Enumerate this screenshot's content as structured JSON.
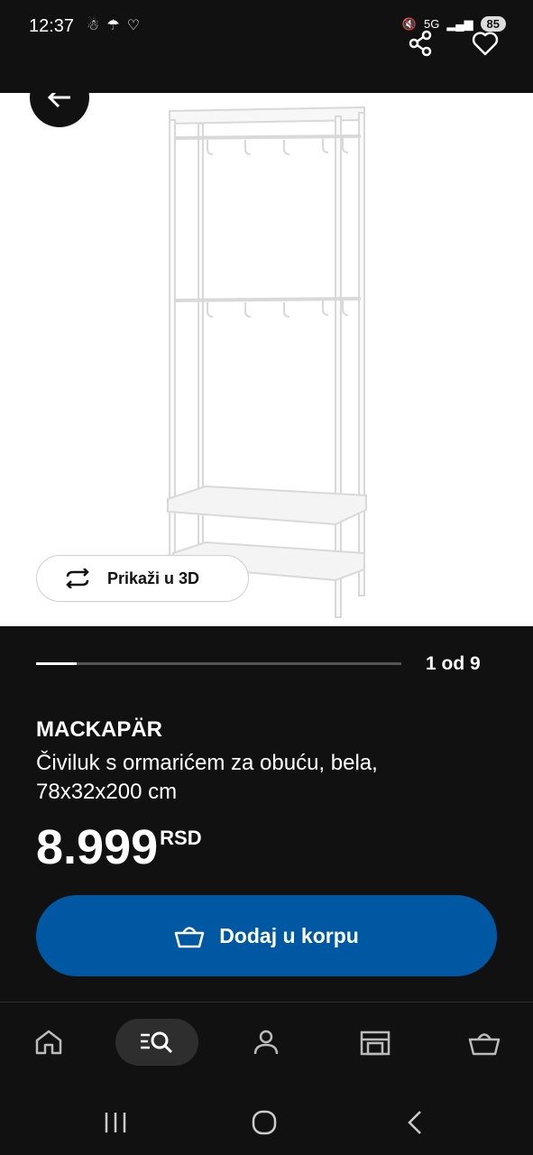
{
  "status_bar": {
    "time": "12:37",
    "network": "5G",
    "battery": "85"
  },
  "header": {
    "back_icon": "arrow-left-icon",
    "share_icon": "share-icon",
    "favorite_icon": "heart-outline-icon"
  },
  "gallery": {
    "view3d_label": "Prikaži u 3D",
    "counter": "1 od 9",
    "progress": 0.11
  },
  "product": {
    "name": "MACKAPÄR",
    "description": "Čiviluk s ormarićem za obuću, bela, 78x32x200 cm",
    "price_value": "8.999",
    "price_currency": "RSD"
  },
  "actions": {
    "add_to_cart_label": "Dodaj u korpu"
  },
  "bottom_nav": {
    "items": [
      "home-icon",
      "search-browse-icon",
      "profile-icon",
      "store-icon",
      "cart-icon"
    ],
    "active": "search-browse-icon"
  },
  "colors": {
    "background": "#111111",
    "primary": "#0058a3",
    "white": "#ffffff"
  }
}
